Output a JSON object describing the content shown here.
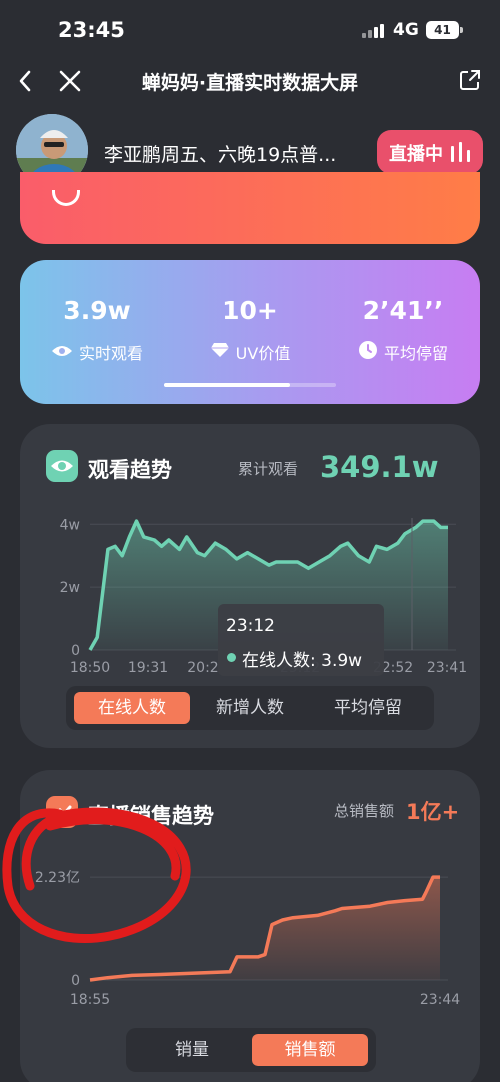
{
  "status_bar": {
    "time": "23:45",
    "network": "4G",
    "battery": "41"
  },
  "nav": {
    "title": "蝉妈妈·直播实时数据大屏"
  },
  "stream": {
    "title": "李亚鹏周五、六晚19点普...",
    "live_label": "直播中"
  },
  "stats": [
    {
      "value": "3.9w",
      "label": "实时观看",
      "icon": "eye-icon"
    },
    {
      "value": "10+",
      "label": "UV价值",
      "icon": "diamond-icon"
    },
    {
      "value": "2’41’’",
      "label": "平均停留",
      "icon": "clock-icon"
    }
  ],
  "watch_trend": {
    "title": "观看趋势",
    "total_label": "累计观看",
    "total_value": "349.1w",
    "tooltip": {
      "time": "23:12",
      "label": "在线人数: 3.9w"
    },
    "tabs": [
      {
        "label": "在线人数",
        "active": true
      },
      {
        "label": "新增人数",
        "active": false
      },
      {
        "label": "平均停留",
        "active": false
      }
    ],
    "accent": "#6fd2b3"
  },
  "sales_trend": {
    "title": "直播销售趋势",
    "total_label": "总销售额",
    "total_value": "1亿+",
    "tabs": [
      {
        "label": "销量",
        "active": false
      },
      {
        "label": "销售额",
        "active": true
      }
    ],
    "accent": "#f47a58"
  },
  "chart_data": [
    {
      "type": "area",
      "title": "观看趋势",
      "ylabel": "",
      "xlabel": "",
      "y_ticks": [
        "0",
        "2w",
        "4w"
      ],
      "x_ticks": [
        "18:50",
        "19:31",
        "20:2",
        "23:12",
        "22:52",
        "23:41"
      ],
      "ylim": [
        0,
        4.2
      ],
      "x": [
        0,
        0.02,
        0.05,
        0.07,
        0.09,
        0.11,
        0.13,
        0.15,
        0.18,
        0.2,
        0.22,
        0.25,
        0.27,
        0.3,
        0.32,
        0.35,
        0.38,
        0.41,
        0.44,
        0.47,
        0.5,
        0.52,
        0.55,
        0.58,
        0.61,
        0.64,
        0.67,
        0.7,
        0.72,
        0.75,
        0.78,
        0.8,
        0.83,
        0.86,
        0.88,
        0.91,
        0.93,
        0.96,
        0.98,
        1.0
      ],
      "series": [
        {
          "values": [
            0.0,
            0.4,
            3.2,
            3.3,
            3.0,
            3.6,
            4.1,
            3.6,
            3.5,
            3.3,
            3.5,
            3.2,
            3.6,
            3.1,
            3.0,
            3.4,
            3.2,
            2.9,
            3.1,
            2.9,
            2.7,
            2.8,
            2.8,
            2.8,
            2.6,
            2.8,
            3.0,
            3.3,
            3.4,
            3.0,
            2.8,
            3.3,
            3.2,
            3.4,
            3.7,
            3.9,
            4.1,
            4.1,
            3.9,
            3.9
          ]
        }
      ],
      "grid": true
    },
    {
      "type": "area",
      "title": "直播销售趋势",
      "ylabel": "",
      "xlabel": "",
      "y_ticks": [
        "0",
        "2.23亿"
      ],
      "x_ticks": [
        "18:55",
        "23:44"
      ],
      "ylim": [
        0,
        2.6
      ],
      "x": [
        0,
        0.05,
        0.12,
        0.2,
        0.3,
        0.4,
        0.42,
        0.48,
        0.5,
        0.52,
        0.55,
        0.58,
        0.65,
        0.7,
        0.72,
        0.8,
        0.85,
        0.9,
        0.95,
        0.96,
        0.98,
        1.0
      ],
      "series": [
        {
          "values": [
            0.0,
            0.05,
            0.1,
            0.12,
            0.15,
            0.18,
            0.5,
            0.5,
            0.55,
            1.2,
            1.3,
            1.35,
            1.4,
            1.5,
            1.55,
            1.6,
            1.68,
            1.72,
            1.75,
            1.9,
            2.23,
            2.23
          ]
        }
      ],
      "grid": true
    }
  ]
}
